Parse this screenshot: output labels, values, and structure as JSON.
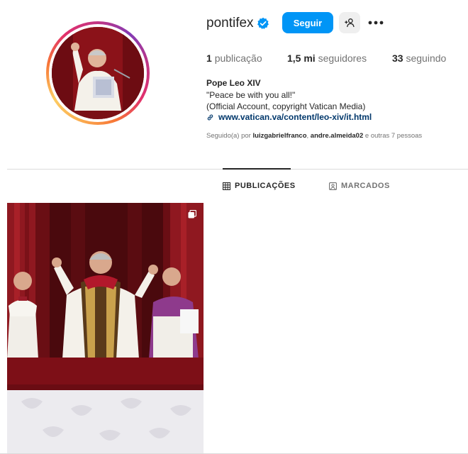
{
  "profile": {
    "username": "pontifex",
    "verified": true,
    "follow_label": "Seguir",
    "name": "Pope Leo XIV",
    "bio_line1": "\"Peace be with you all!\"",
    "bio_line2": "(Official Account, copyright Vatican Media)",
    "link": "www.vatican.va/content/leo-xiv/it.html"
  },
  "stats": {
    "posts_count": "1",
    "posts_label": "publicação",
    "followers_count": "1,5 mi",
    "followers_label": "seguidores",
    "following_count": "33",
    "following_label": "seguindo"
  },
  "followed_by": {
    "prefix": "Seguido(a) por",
    "user1": "luizgabrielfranco",
    "separator": ",",
    "user2": "andre.almeida02",
    "suffix": "e outras 7 pessoas"
  },
  "tabs": [
    {
      "label": "PUBLICAÇÕES",
      "active": true
    },
    {
      "label": "MARCADOS",
      "active": false
    }
  ],
  "colors": {
    "accent": "#0095f6",
    "verified": "#0095f6",
    "link": "#00376b"
  },
  "icons": {
    "verified": "verified-badge-icon",
    "suggest": "person-plus-icon",
    "more": "more-options-icon",
    "link": "link-icon",
    "posts_tab": "grid-icon",
    "tagged_tab": "tagged-icon",
    "multi_post": "carousel-icon"
  }
}
